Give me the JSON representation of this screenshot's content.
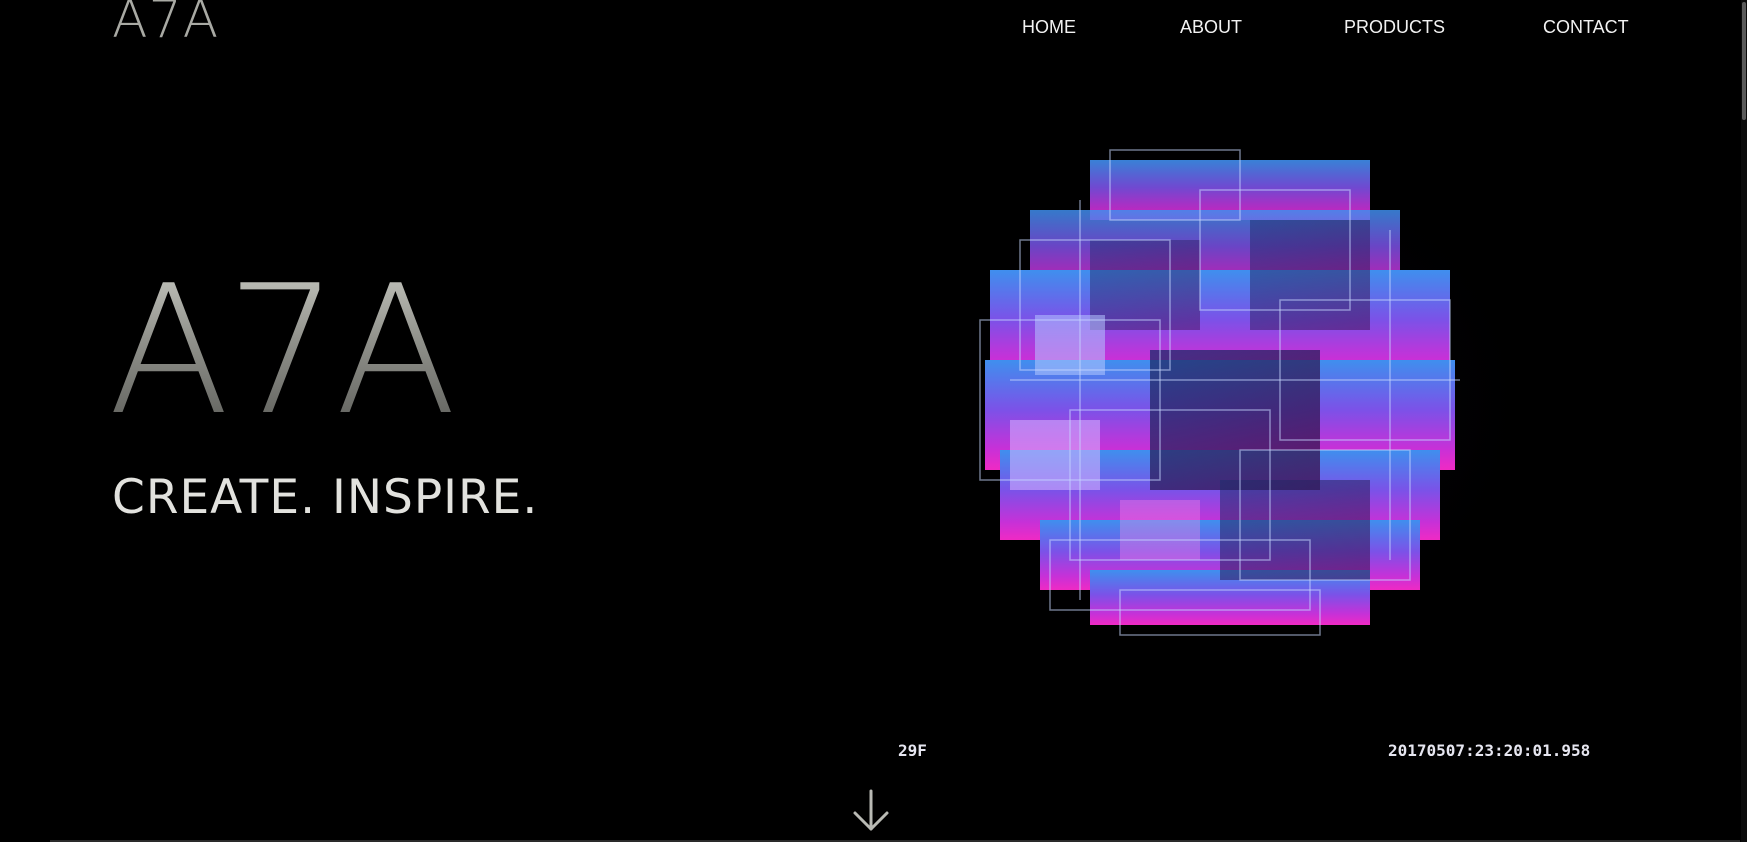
{
  "header": {
    "logo_text": "A7A",
    "nav": [
      {
        "label": "HOME"
      },
      {
        "label": "ABOUT"
      },
      {
        "label": "PRODUCTS"
      },
      {
        "label": "CONTACT"
      }
    ]
  },
  "hero": {
    "title": "A7A",
    "tagline": "CREATE. INSPIRE.",
    "video_overlay": {
      "left_label": "29F",
      "timestamp": "20170507:23:20:01.958"
    }
  },
  "icons": {
    "scroll": "arrow-down-icon"
  },
  "colors": {
    "background": "#000000",
    "cube_top": "#3f86e6",
    "cube_mid": "#8a4df0",
    "cube_bottom": "#e02bd0"
  }
}
